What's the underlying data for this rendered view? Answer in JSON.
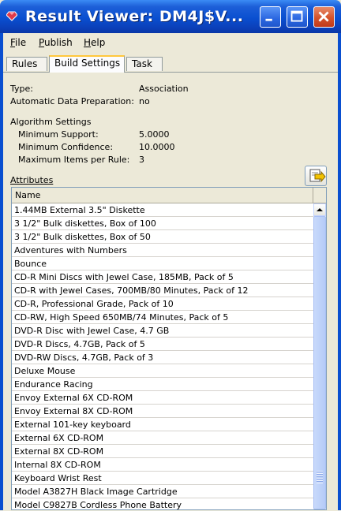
{
  "window": {
    "title": "Result Viewer: DM4J$V...",
    "controls": {
      "minimize": "minimize",
      "maximize": "maximize",
      "close": "close"
    }
  },
  "menu": {
    "file": "File",
    "publish": "Publish",
    "help": "Help"
  },
  "tabs": {
    "rules": "Rules",
    "build_settings": "Build Settings",
    "task": "Task",
    "active": "Build Settings"
  },
  "settings": {
    "type_label": "Type:",
    "type_value": "Association",
    "adp_label": "Automatic Data Preparation:",
    "adp_value": "no",
    "algo_heading": "Algorithm Settings",
    "min_support_label": "Minimum Support:",
    "min_support_value": "5.0000",
    "min_confidence_label": "Minimum Confidence:",
    "min_confidence_value": "10.0000",
    "max_items_label": "Maximum Items per Rule:",
    "max_items_value": "3"
  },
  "attributes": {
    "heading": "Attributes",
    "column_name": "Name",
    "rows": [
      "1.44MB External 3.5\" Diskette",
      "3 1/2\" Bulk diskettes, Box of 100",
      "3 1/2\" Bulk diskettes, Box of 50",
      "Adventures with Numbers",
      "Bounce",
      "CD-R Mini Discs with Jewel Case, 185MB, Pack of 5",
      "CD-R with Jewel Cases, 700MB/80 Minutes, Pack of 12",
      "CD-R, Professional Grade, Pack of 10",
      "CD-RW, High Speed 650MB/74 Minutes, Pack of 5",
      "DVD-R Disc with Jewel Case, 4.7 GB",
      "DVD-R Discs, 4.7GB, Pack of 5",
      "DVD-RW Discs, 4.7GB, Pack of 3",
      "Deluxe Mouse",
      "Endurance Racing",
      "Envoy External 6X CD-ROM",
      "Envoy External 8X CD-ROM",
      "External 101-key keyboard",
      "External 6X CD-ROM",
      "External 8X CD-ROM",
      "Internal 8X CD-ROM",
      "Keyboard Wrist Rest",
      "Model A3827H Black Image Cartridge",
      "Model C9827B Cordless Phone Battery"
    ]
  },
  "colors": {
    "titlebar": "#0a4fd0",
    "window_bg": "#ece9d8",
    "tab_highlight": "#ffc73c",
    "close_button": "#d5532b"
  },
  "icons": {
    "app": "gem-icon",
    "export": "export-icon"
  }
}
